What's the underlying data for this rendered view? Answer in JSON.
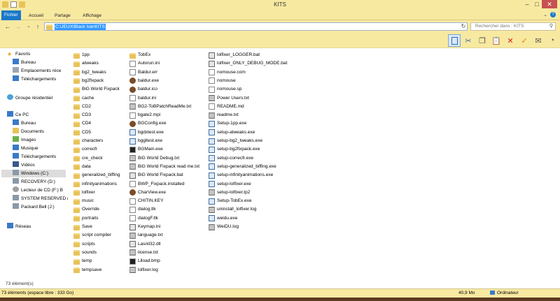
{
  "window": {
    "title": "KITS"
  },
  "ribbon": {
    "tabs": [
      "Fichier",
      "Accueil",
      "Partage",
      "Affichage"
    ]
  },
  "address": {
    "path": "C:\\JEUX\\Black Isle\\KITS",
    "search_placeholder": "Rechercher dans : KITS"
  },
  "sidebar": {
    "favorites": {
      "label": "Favoris",
      "items": [
        "Bureau",
        "Emplacements réce",
        "Téléchargements"
      ]
    },
    "homegroup": "Groupe résidentiel",
    "pc": {
      "label": "Ce PC",
      "items": [
        "Bureau",
        "Documents",
        "Images",
        "Musique",
        "Téléchargements",
        "Vidéos",
        "Windows (C:)",
        "RECOVERY (D:)",
        "Lecteur de CD (F:) B",
        "SYSTEM RESERVED (",
        "Packard Bell (J:)"
      ]
    },
    "network": "Réseau"
  },
  "files": {
    "col1": [
      {
        "name": "1pp",
        "type": "folder"
      },
      {
        "name": "atweaks",
        "type": "folder"
      },
      {
        "name": "bg2_tweaks",
        "type": "folder"
      },
      {
        "name": "bg2fixpack",
        "type": "folder"
      },
      {
        "name": "BiG World Fixpack",
        "type": "folder"
      },
      {
        "name": "cache",
        "type": "folder"
      },
      {
        "name": "CD2",
        "type": "folder"
      },
      {
        "name": "CD3",
        "type": "folder"
      },
      {
        "name": "CD4",
        "type": "folder"
      },
      {
        "name": "CD5",
        "type": "folder"
      },
      {
        "name": "characters",
        "type": "folder"
      },
      {
        "name": "correcfr",
        "type": "folder"
      },
      {
        "name": "cre_check",
        "type": "folder"
      },
      {
        "name": "data",
        "type": "folder"
      },
      {
        "name": "generalized_biffing",
        "type": "folder"
      },
      {
        "name": "infinityanimations",
        "type": "folder"
      },
      {
        "name": "lolfixer",
        "type": "folder"
      },
      {
        "name": "music",
        "type": "folder"
      },
      {
        "name": "Override",
        "type": "folder"
      },
      {
        "name": "portraits",
        "type": "folder"
      },
      {
        "name": "Save",
        "type": "folder"
      },
      {
        "name": "script compiler",
        "type": "folder"
      },
      {
        "name": "scripts",
        "type": "folder"
      },
      {
        "name": "sounds",
        "type": "folder"
      },
      {
        "name": "temp",
        "type": "folder"
      },
      {
        "name": "tempsave",
        "type": "folder"
      }
    ],
    "col2": [
      {
        "name": "TobEx",
        "type": "folder"
      },
      {
        "name": "Autorun.ini",
        "type": "file"
      },
      {
        "name": "Baldur.err",
        "type": "file"
      },
      {
        "name": "baldur.exe",
        "type": "gear"
      },
      {
        "name": "baldur.ico",
        "type": "gear"
      },
      {
        "name": "baldur.ini",
        "type": "file"
      },
      {
        "name": "BG2-ToBPatchReadMe.txt",
        "type": "txt"
      },
      {
        "name": "bgate2.mpi",
        "type": "file"
      },
      {
        "name": "BGConfig.exe",
        "type": "gear"
      },
      {
        "name": "bgdxtest.exe",
        "type": "exe"
      },
      {
        "name": "bggltest.exe",
        "type": "exe"
      },
      {
        "name": "BGMain.exe",
        "type": "img"
      },
      {
        "name": "BiG World Debug.txt",
        "type": "txt"
      },
      {
        "name": "BiG World Fixpack read me.txt",
        "type": "txt"
      },
      {
        "name": "BiG World Fixpack.bat",
        "type": "bat"
      },
      {
        "name": "BWP_Fixpack.installed",
        "type": "file"
      },
      {
        "name": "CharView.exe",
        "type": "gear"
      },
      {
        "name": "CHITIN.KEY",
        "type": "file"
      },
      {
        "name": "dialog.tlk",
        "type": "file"
      },
      {
        "name": "dialogF.tlk",
        "type": "file"
      },
      {
        "name": "Keymap.ini",
        "type": "bat"
      },
      {
        "name": "language.txt",
        "type": "txt"
      },
      {
        "name": "Lasnil32.dll",
        "type": "bat"
      },
      {
        "name": "license.txt",
        "type": "txt"
      },
      {
        "name": "Llload.bmp",
        "type": "img"
      },
      {
        "name": "lolfixer.log",
        "type": "txt"
      }
    ],
    "col3": [
      {
        "name": "lolfixer_LOGGER.bat",
        "type": "bat"
      },
      {
        "name": "lolfixer_ONLY_DEBUG_MODE.bat",
        "type": "bat"
      },
      {
        "name": "nomouse.com",
        "type": "file"
      },
      {
        "name": "nomouse",
        "type": "file"
      },
      {
        "name": "nomouse.sp",
        "type": "file"
      },
      {
        "name": "Power Users.txt",
        "type": "txt"
      },
      {
        "name": "README.md",
        "type": "file"
      },
      {
        "name": "readme.txt",
        "type": "txt"
      },
      {
        "name": "Setup-1pp.exe",
        "type": "exe"
      },
      {
        "name": "setup-atweaks.exe",
        "type": "exe"
      },
      {
        "name": "setup-bg2_tweaks.exe",
        "type": "exe"
      },
      {
        "name": "setup-bg2fixpack.exe",
        "type": "exe"
      },
      {
        "name": "setup-correcfr.exe",
        "type": "exe"
      },
      {
        "name": "setup-generalized_biffing.exe",
        "type": "exe"
      },
      {
        "name": "setup-infinityanimations.exe",
        "type": "exe"
      },
      {
        "name": "setup-lolfixer.exe",
        "type": "exe"
      },
      {
        "name": "setup-lolfixer.tp2",
        "type": "txt"
      },
      {
        "name": "Setup-TobEx.exe",
        "type": "exe"
      },
      {
        "name": "uninstall_lolfixer.log",
        "type": "txt"
      },
      {
        "name": "weidu.exe",
        "type": "exe"
      },
      {
        "name": "WeiDU.log",
        "type": "txt"
      }
    ]
  },
  "status": {
    "count": "73 élément(s)",
    "left": "73 éléments (espace libre : 333 Go)",
    "size": "40,9 Mo",
    "computer": "Ordinateur"
  }
}
